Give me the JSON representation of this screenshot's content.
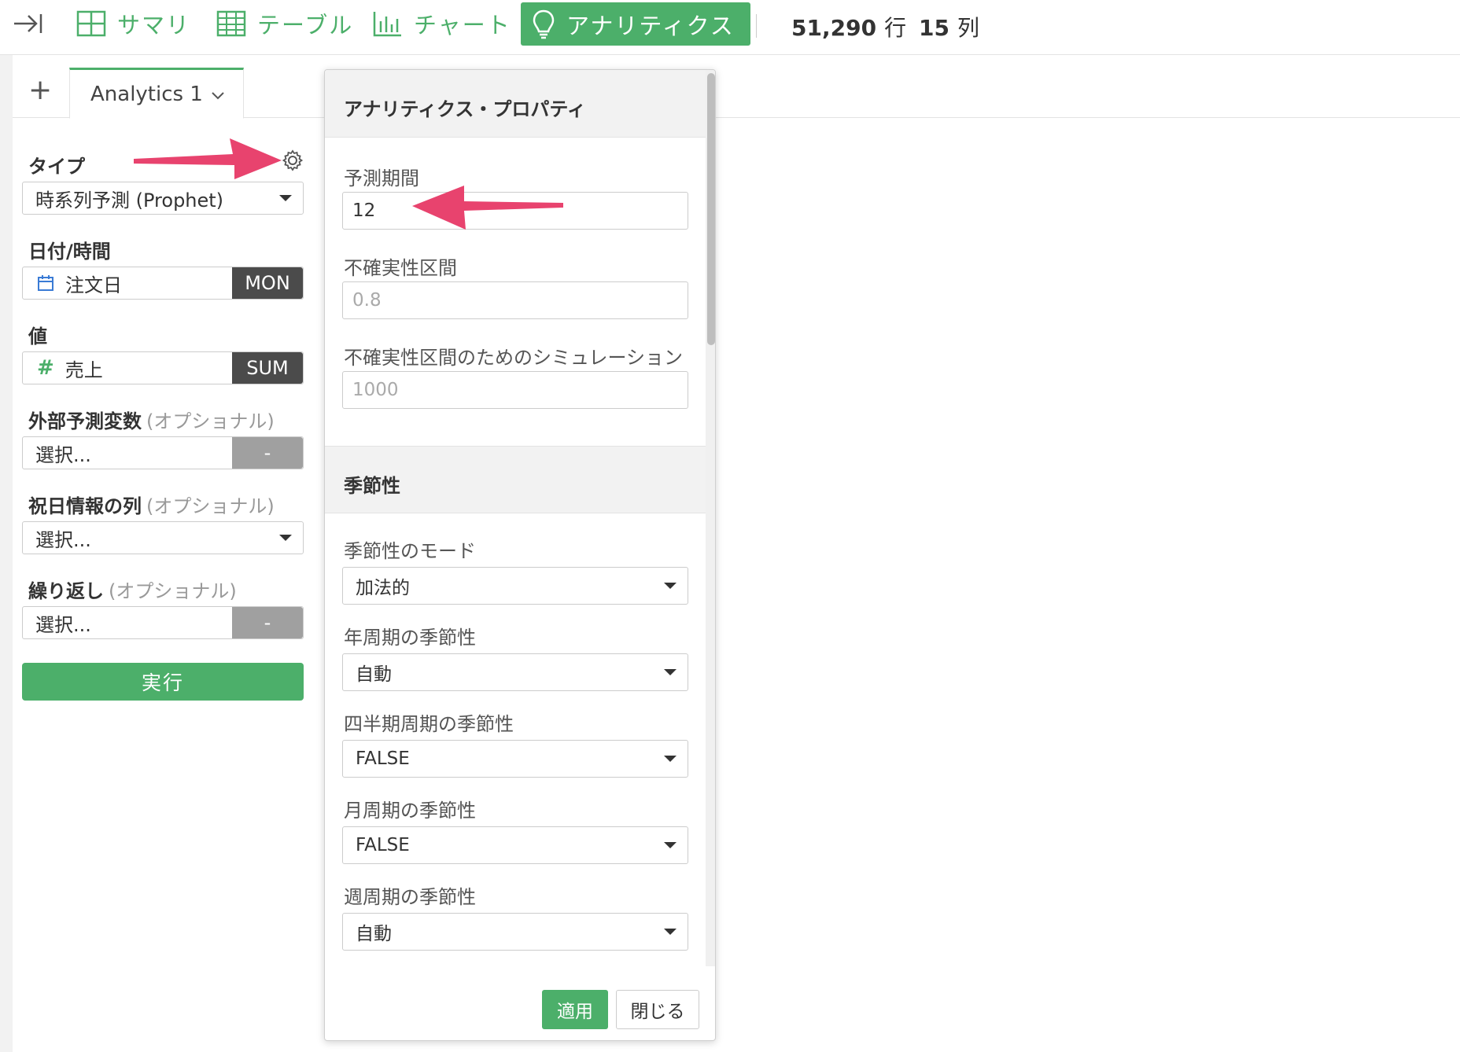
{
  "topbar": {
    "collapse_icon": "collapse-right-icon",
    "summary_label": "サマリ",
    "table_label": "テーブル",
    "chart_label": "チャート",
    "analytics_label": "アナリティクス",
    "rows_value": "51,290",
    "rows_unit": "行",
    "cols_value": "15",
    "cols_unit": "列"
  },
  "tabs": {
    "add_label": "+",
    "active_label": "Analytics 1"
  },
  "config": {
    "type_label": "タイプ",
    "type_value": "時系列予測 (Prophet)",
    "date_label": "日付/時間",
    "date_value": "注文日",
    "date_agg": "MON",
    "value_label": "値",
    "value_value": "売上",
    "value_agg": "SUM",
    "external_label": "外部予測変数",
    "external_optional": "(オプショナル)",
    "external_value": "選択...",
    "external_suffix": "-",
    "holiday_label": "祝日情報の列",
    "holiday_optional": "(オプショナル)",
    "holiday_value": "選択...",
    "repeat_label": "繰り返し",
    "repeat_optional": "(オプショナル)",
    "repeat_value": "選択...",
    "repeat_suffix": "-",
    "run_label": "実行"
  },
  "popup": {
    "title": "アナリティクス・プロパティ",
    "forecast_label": "予測期間",
    "forecast_value": "12",
    "uncertainty_label": "不確実性区間",
    "uncertainty_placeholder": "0.8",
    "simulation_label": "不確実性区間のためのシミュレーション",
    "simulation_placeholder": "1000",
    "seasonality_section": "季節性",
    "mode_label": "季節性のモード",
    "mode_value": "加法的",
    "yearly_label": "年周期の季節性",
    "yearly_value": "自動",
    "quarterly_label": "四半期周期の季節性",
    "quarterly_value": "FALSE",
    "monthly_label": "月周期の季節性",
    "monthly_value": "FALSE",
    "weekly_label": "週周期の季節性",
    "weekly_value": "自動",
    "apply_label": "適用",
    "close_label": "閉じる"
  },
  "colors": {
    "accent": "#4caf6a",
    "dark_suffix": "#4b4b4b",
    "annotation": "#e8436e"
  }
}
